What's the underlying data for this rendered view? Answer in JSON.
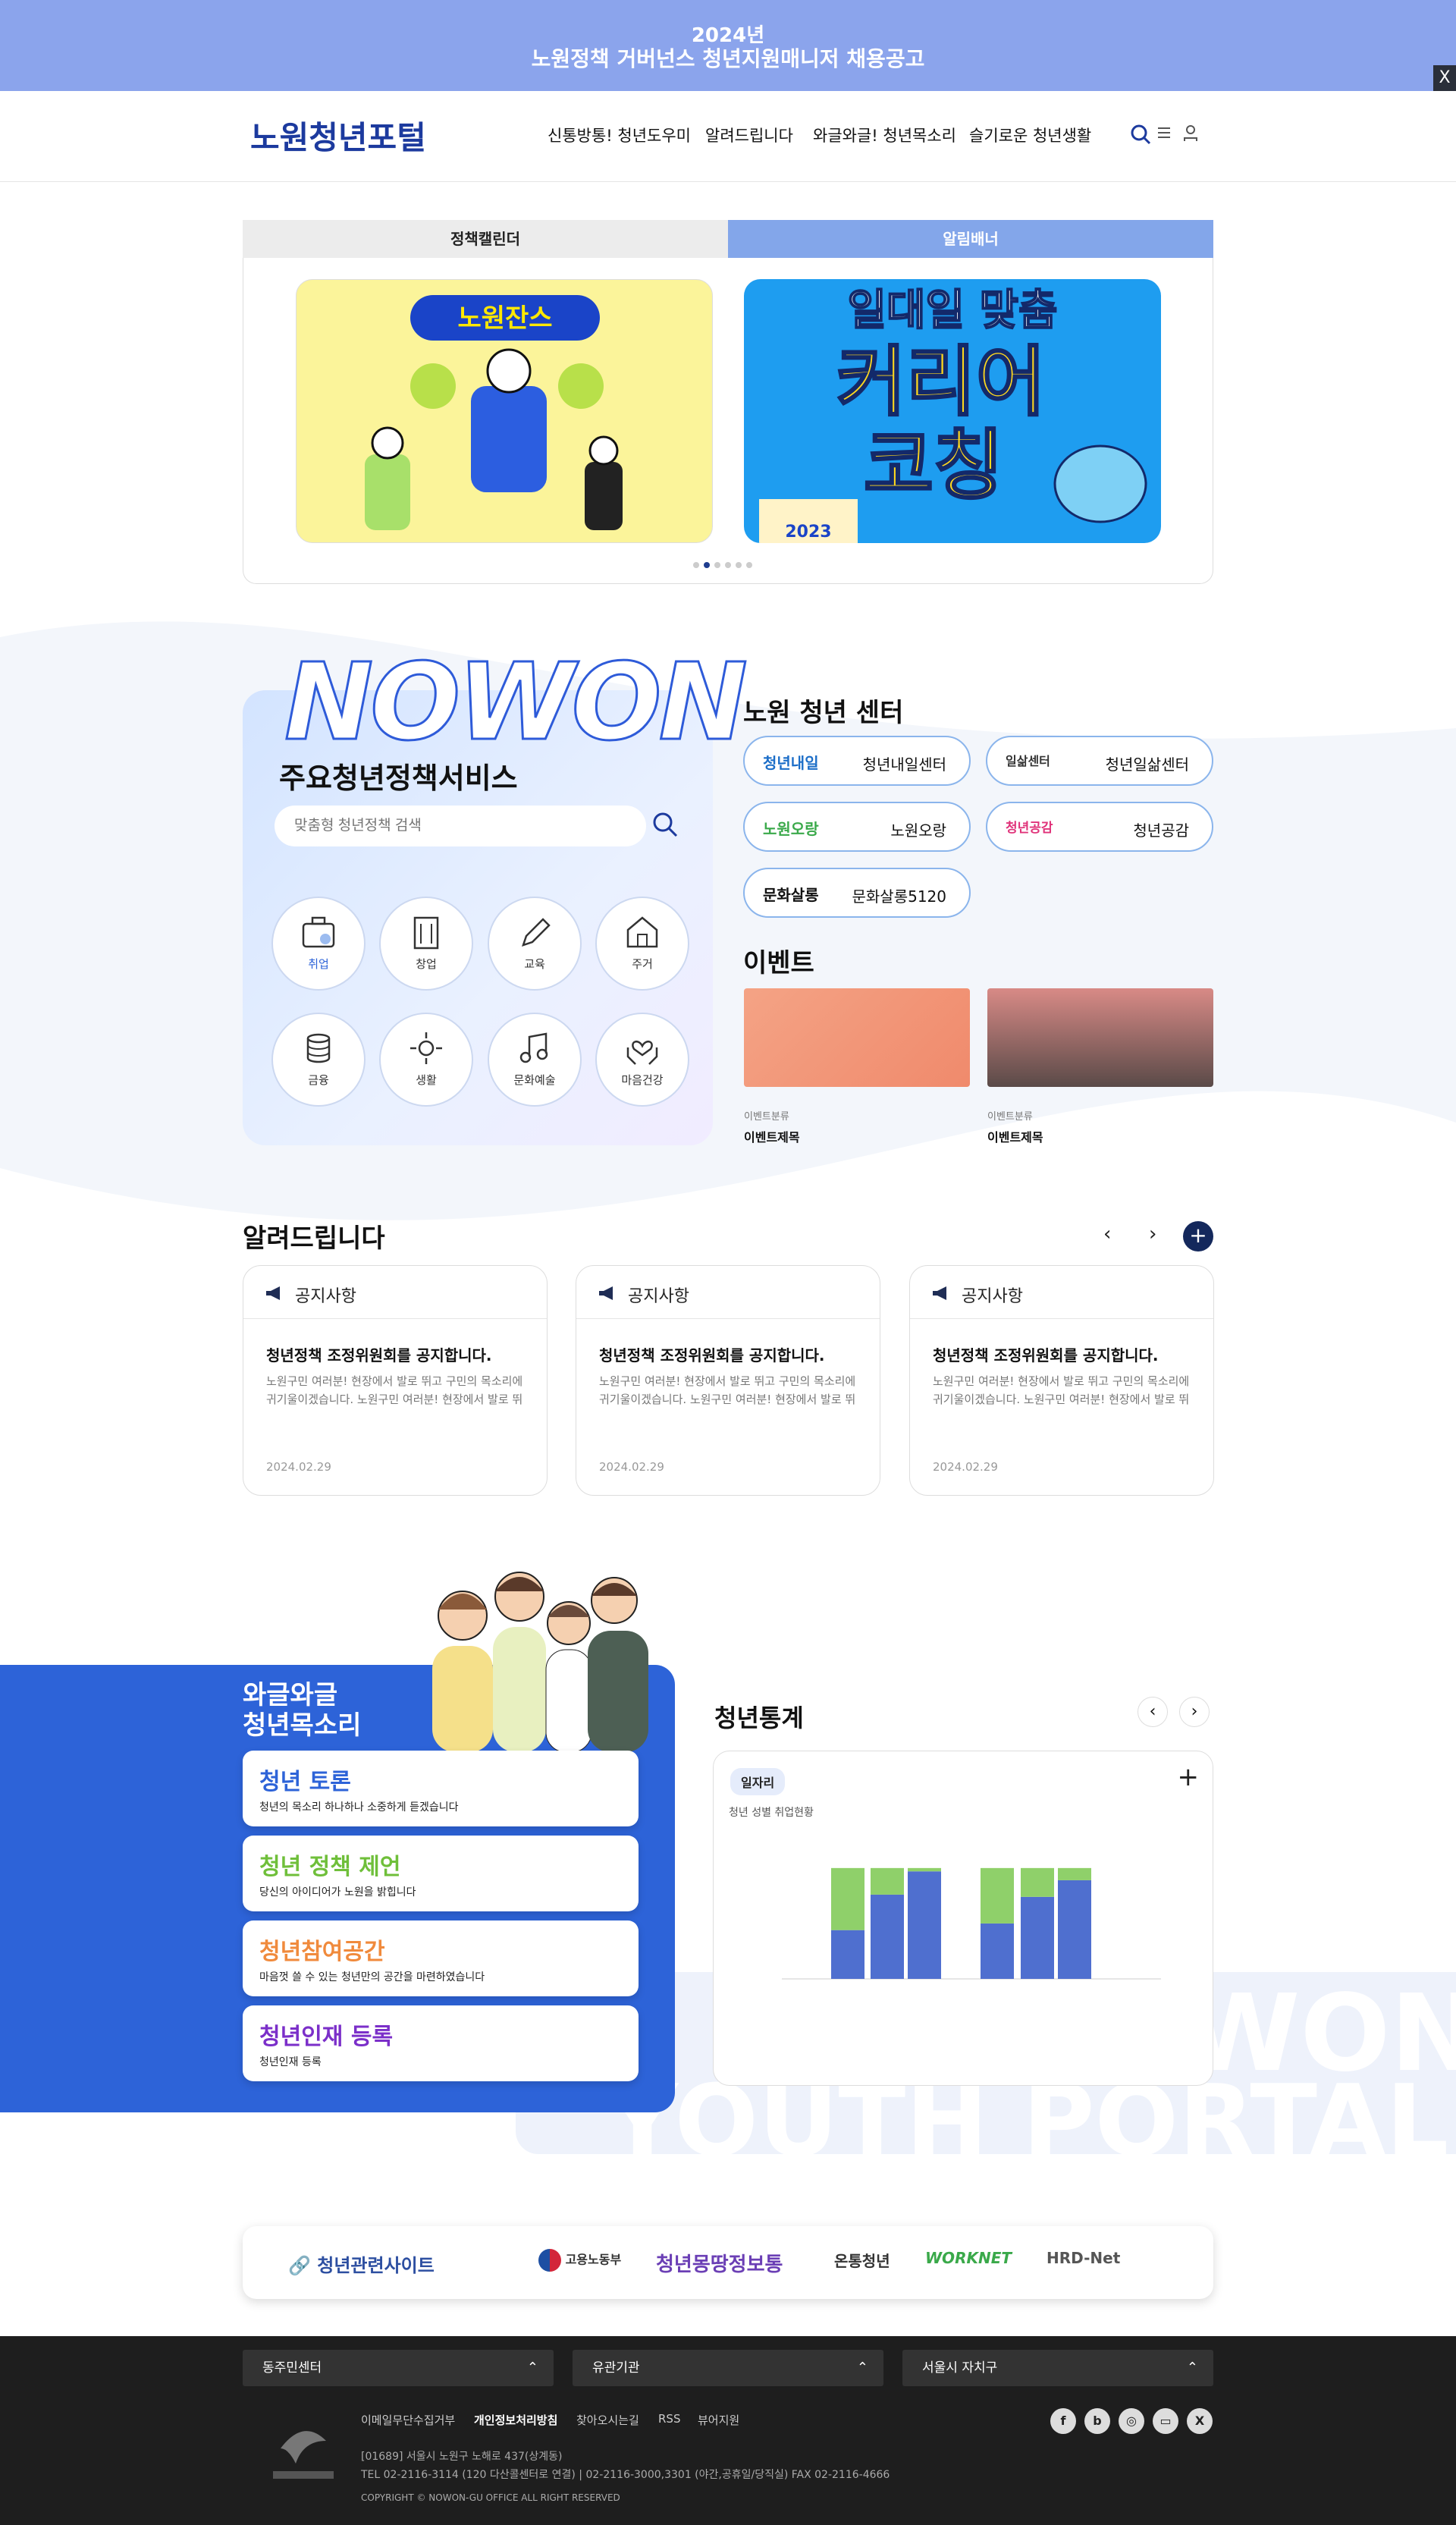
{
  "banner": {
    "line1": "2024년",
    "line2": "노원정책 거버넌스 청년지원매니저 채용공고",
    "close": "X"
  },
  "header": {
    "logo": "노원청년포털",
    "nav": [
      "신통방통! 청년도우미",
      "알려드립니다",
      "와글와글! 청년목소리",
      "슬기로운 청년생활"
    ]
  },
  "tabs": [
    "정책캘린더",
    "알림배너"
  ],
  "slides": {
    "slide1_text": "노원잔스",
    "slide2_l1": "일대일 맞춤",
    "slide2_l2": "커리어",
    "slide2_l3": "코칭",
    "slide2_year": "2023"
  },
  "services": {
    "nowon": "NOWON",
    "title": "주요청년정책서비스",
    "search_placeholder": "맞춤형 청년정책 검색",
    "items": [
      "취업",
      "창업",
      "교육",
      "주거",
      "금융",
      "생활",
      "문화예술",
      "마음건강"
    ]
  },
  "centers": {
    "title": "노원 청년 센터",
    "items": [
      {
        "logo": "청년내일",
        "name": "청년내일센터"
      },
      {
        "logo": "일삶센터",
        "name": "청년일삶센터"
      },
      {
        "logo": "노원오랑",
        "name": "노원오랑"
      },
      {
        "logo": "청년공감",
        "name": "청년공감"
      },
      {
        "logo": "문화살롱",
        "name": "문화살롱5120"
      }
    ]
  },
  "events": {
    "title": "이벤트",
    "items": [
      {
        "cat": "이벤트분류",
        "title": "이벤트제목"
      },
      {
        "cat": "이벤트분류",
        "title": "이벤트제목"
      }
    ]
  },
  "notices": {
    "title": "알려드립니다",
    "prev": "‹",
    "next": "›",
    "more": "+",
    "items": [
      {
        "cat": "공지사항",
        "title": "청년정책 조정위원회를 공지합니다.",
        "excerpt": "노원구민 여러분! 현장에서 발로 뛰고 구민의 목소리에 귀기울이겠습니다. 노원구민 여러분! 현장에서 발로 뛰고 구민의 목소리에 귀기울이겠습니다.",
        "date": "2024.02.29"
      },
      {
        "cat": "공지사항",
        "title": "청년정책 조정위원회를 공지합니다.",
        "excerpt": "노원구민 여러분! 현장에서 발로 뛰고 구민의 목소리에 귀기울이겠습니다. 노원구민 여러분! 현장에서 발로 뛰고 구민의 목소리에 귀기울이겠습니다.",
        "date": "2024.02.29"
      },
      {
        "cat": "공지사항",
        "title": "청년정책 조정위원회를 공지합니다.",
        "excerpt": "노원구민 여러분! 현장에서 발로 뛰고 구민의 목소리에 귀기울이겠습니다. 노원구민 여러분! 현장에서 발로 뛰고 구민의 목소리에 귀기울이겠습니다.",
        "date": "2024.02.29"
      }
    ]
  },
  "voice": {
    "title_l1": "와글와글",
    "title_l2": "청년목소리",
    "items": [
      {
        "title": "청년 토론",
        "sub": "청년의 목소리 하나하나 소중하게 듣겠습니다",
        "color": "#2d63d8"
      },
      {
        "title": "청년 정책 제언",
        "sub": "당신의 아이디어가 노원을 밝힙니다",
        "color": "#6fbf3a"
      },
      {
        "title": "청년참여공간",
        "sub": "마음껏 쓸 수 있는 청년만의 공간을 마련하였습니다",
        "color": "#f08a3c"
      },
      {
        "title": "청년인재 등록",
        "sub": "청년인재 등록",
        "color": "#7b2fc9"
      }
    ]
  },
  "watermark": {
    "l1": "WON",
    "l2": "YOUTH PORTAL"
  },
  "stats": {
    "title": "청년통계",
    "prev": "‹",
    "next": "›",
    "tag": "일자리",
    "plus": "+",
    "chart_title": "청년 성별 취업현황"
  },
  "chart_data": {
    "type": "bar",
    "stacked": true,
    "series": [
      {
        "name": "",
        "color": "#4f6fcf",
        "values": [
          44,
          76,
          97,
          50,
          74,
          89
        ]
      },
      {
        "name": "",
        "color": "#8fd06a",
        "values": [
          56,
          24,
          3,
          50,
          26,
          11
        ]
      }
    ],
    "ylim": [
      0,
      130
    ],
    "colors": [
      "#4f6fcf",
      "#8fd06a"
    ]
  },
  "sites": {
    "label": "청년관련사이트",
    "items": [
      "고용노동부",
      "청년몽땅정보통",
      "온통청년",
      "WORKNET",
      "HRD-Net"
    ]
  },
  "footer": {
    "selects": [
      "동주민센터",
      "유관기관",
      "서울시 자치구"
    ],
    "links": [
      "이메일무단수집거부",
      "개인정보처리방침",
      "찾아오시는길",
      "RSS",
      "뷰어지원"
    ],
    "addr1": "[01689] 서울시 노원구 노해로 437(상계동)",
    "addr2": "TEL 02-2116-3114 (120 다산콜센터로 연결) | 02-2116-3000,3301 (야간,공휴일/당직실)     FAX 02-2116-4666",
    "copy": "COPYRIGHT © NOWON-GU OFFICE ALL RIGHT RESERVED",
    "social": [
      "f",
      "b",
      "◎",
      "▭",
      "X"
    ]
  }
}
